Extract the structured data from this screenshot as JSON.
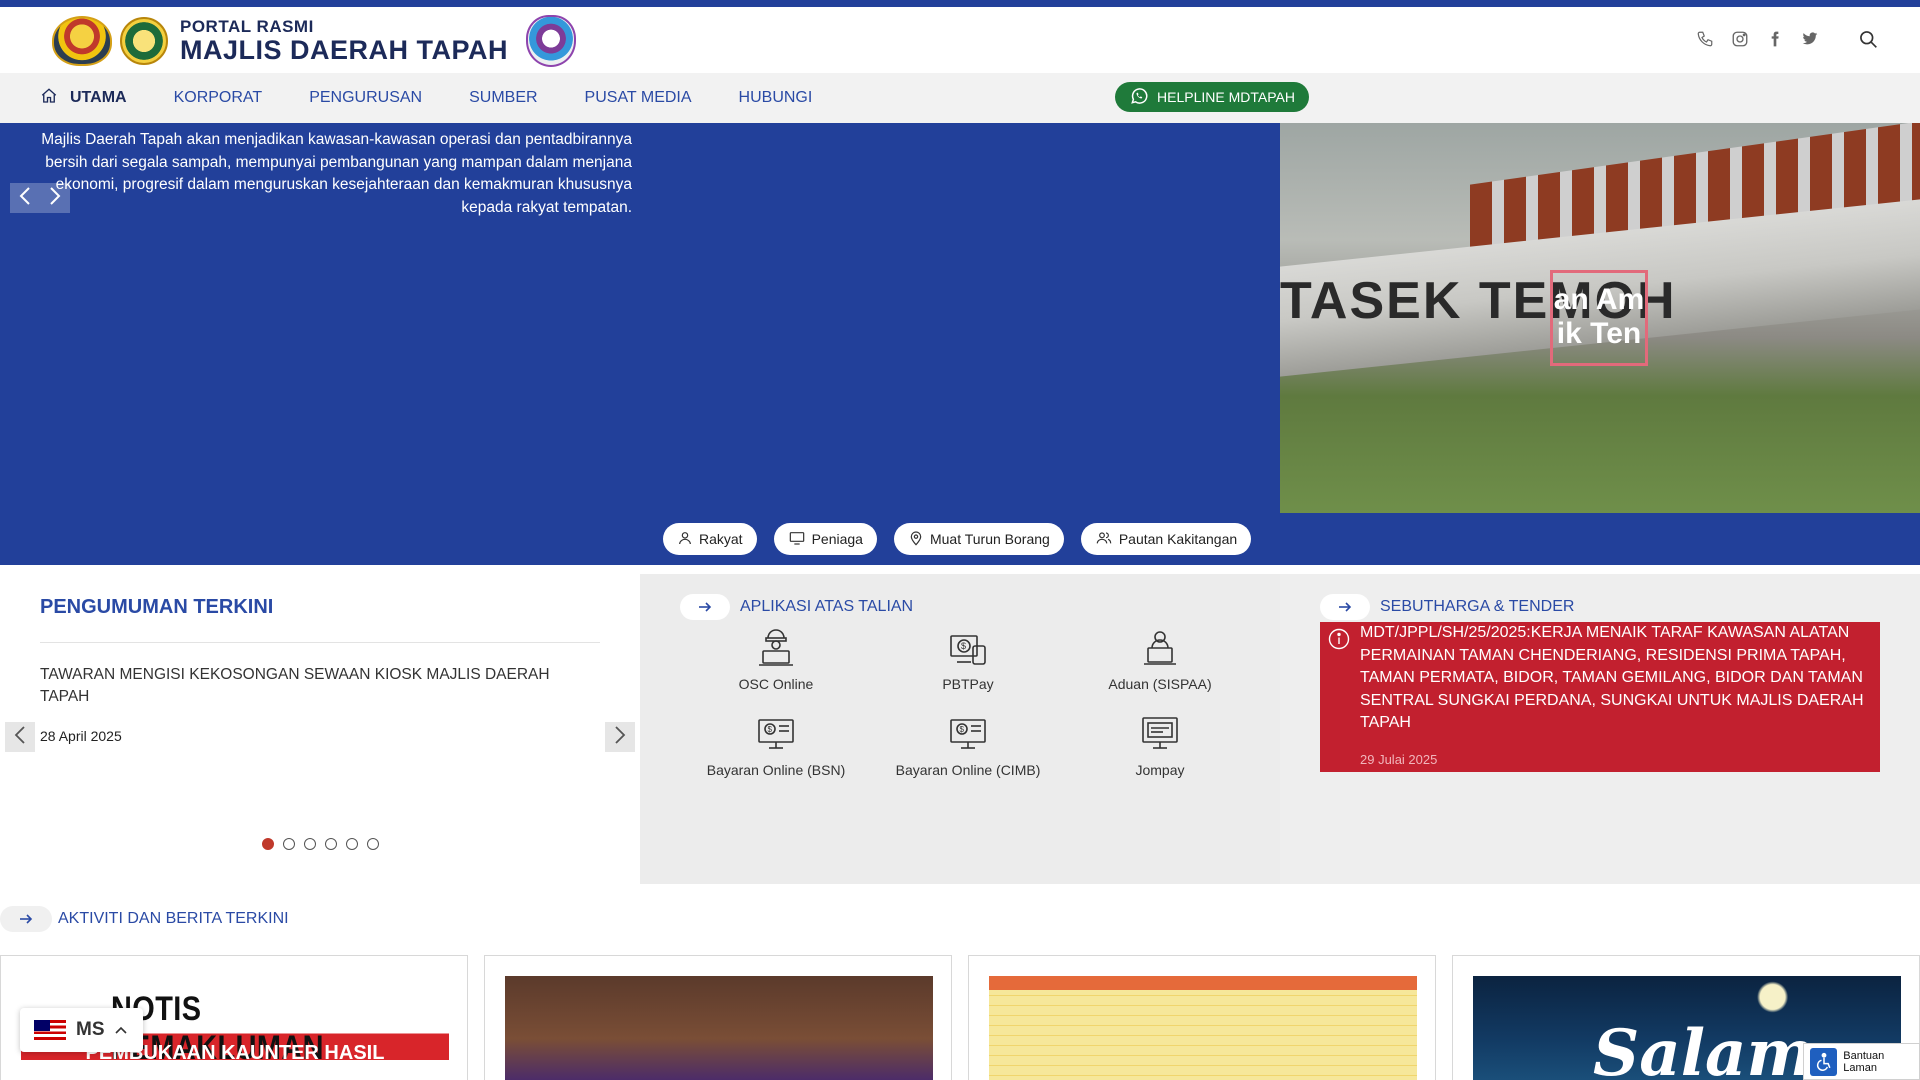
{
  "header": {
    "logo_small": "PORTAL RASMI",
    "logo_big": "MAJLIS DAERAH TAPAH",
    "icons": [
      "phone-icon",
      "instagram-icon",
      "facebook-icon",
      "twitter-icon",
      "search-icon"
    ]
  },
  "nav": {
    "items": [
      {
        "label": "UTAMA"
      },
      {
        "label": "KORPORAT"
      },
      {
        "label": "PENGURUSAN"
      },
      {
        "label": "SUMBER"
      },
      {
        "label": "PUSAT MEDIA"
      },
      {
        "label": "HUBUNGI"
      }
    ],
    "helpline": "HELPLINE MDTAPAH"
  },
  "hero": {
    "text": "Majlis Daerah Tapah akan menjadikan kawasan-kawasan operasi dan pentadbirannya bersih dari segala sampah, mempunyai pembangunan yang mampan dalam menjana ekonomi, progresif dalam menguruskan kesejahteraan dan kemakmuran khususnya kepada rakyat tempatan.",
    "photo_sign": "TASEK TEMOH",
    "photo_overlay": "an Am\nik Ten",
    "pills": [
      {
        "label": "Rakyat",
        "icon": "user-icon"
      },
      {
        "label": "Peniaga",
        "icon": "monitor-icon"
      },
      {
        "label": "Muat Turun Borang",
        "icon": "location-pin-icon"
      },
      {
        "label": "Pautan Kakitangan",
        "icon": "users-icon"
      }
    ]
  },
  "announce": {
    "title": "PENGUMUMAN TERKINI",
    "item": "TAWARAN MENGISI KEKOSONGAN SEWAAN KIOSK MAJLIS DAERAH TAPAH",
    "date": "28 April 2025",
    "dots": 6,
    "active_dot": 0
  },
  "apps": {
    "title": "APLIKASI ATAS TALIAN",
    "items": [
      {
        "label": "OSC Online",
        "icon": "engineer-icon"
      },
      {
        "label": "PBTPay",
        "icon": "payment-computer-icon"
      },
      {
        "label": "Aduan (SISPAA)",
        "icon": "complaint-icon"
      },
      {
        "label": "Bayaran Online (BSN)",
        "icon": "online-payment-icon"
      },
      {
        "label": "Bayaran Online (CIMB)",
        "icon": "online-payment-icon"
      },
      {
        "label": "Jompay",
        "icon": "screen-icon"
      }
    ]
  },
  "tender": {
    "title": "SEBUTHARGA & TENDER",
    "text": "MDT/JPPL/SH/25/2025:KERJA MENAIK TARAF KAWASAN ALATAN PERMAINAN TAMAN CHENDERIANG, RESIDENSI PRIMA TAPAH, TAMAN PERMATA, BIDOR, TAMAN GEMILANG, BIDOR DAN TAMAN SENTRAL SUNGKAI PERDANA, SUNGKAI UNTUK MAJLIS DAERAH TAPAH",
    "date": "29 Julai 2025"
  },
  "news": {
    "title": "AKTIVITI DAN BERITA TERKINI",
    "card1_title": "NOTIS PEMAKLUMAN",
    "card1_sub": "PEMBUKAAN KAUNTER HASIL",
    "card4_text": "Salam"
  },
  "lang": {
    "label": "MS"
  },
  "access": {
    "label": "Bantuan Laman"
  },
  "colors": {
    "primary": "#22409a",
    "accent_red": "#c2202f",
    "helpline_green": "#1f7a3a"
  }
}
